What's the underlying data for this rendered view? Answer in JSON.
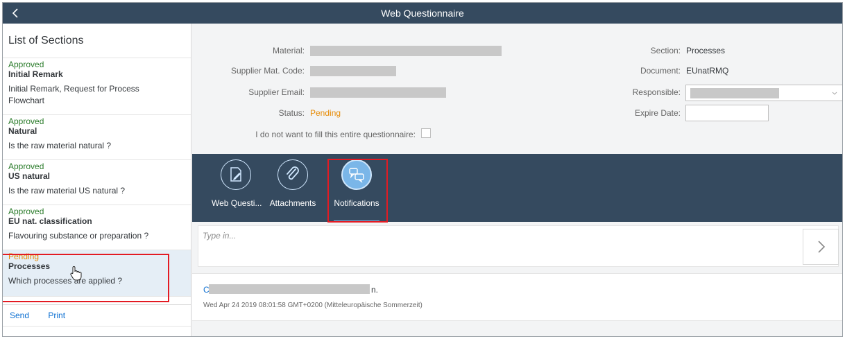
{
  "app": {
    "title": "Web Questionnaire",
    "back_glyph": "‹"
  },
  "master": {
    "header": "List of Sections",
    "items": [
      {
        "status": "Approved",
        "name": "Initial Remark",
        "desc": "Initial Remark, Request for Process Flowchart"
      },
      {
        "status": "Approved",
        "name": "Natural",
        "desc": "Is the raw material natural ?"
      },
      {
        "status": "Approved",
        "name": "US natural",
        "desc": "Is the raw material US natural ?"
      },
      {
        "status": "Approved",
        "name": "EU nat. classification",
        "desc": "Flavouring substance or preparation ?"
      },
      {
        "status": "Pending",
        "name": "Processes",
        "desc": "Which processes are applied ?"
      }
    ],
    "footer": {
      "send": "Send",
      "print": "Print"
    }
  },
  "form": {
    "material_label": "Material:",
    "supplier_code_label": "Supplier Mat. Code:",
    "supplier_email_label": "Supplier Email:",
    "status_label": "Status:",
    "status_value": "Pending",
    "opt_out_label": "I do not want to fill this entire questionnaire:",
    "section_label": "Section:",
    "section_value": "Processes",
    "document_label": "Document:",
    "document_value": "EUnatRMQ",
    "responsible_label": "Responsible:",
    "expire_label": "Expire Date:"
  },
  "tabs": [
    {
      "label": "Web Questi...",
      "icon": "edit-document-icon"
    },
    {
      "label": "Attachments",
      "icon": "paperclip-icon"
    },
    {
      "label": "Notifications",
      "icon": "discussion-icon"
    }
  ],
  "feed": {
    "placeholder": "Type in...",
    "post_glyph": "›"
  },
  "notification": {
    "author_initial": "C",
    "text_tail": "n.",
    "timestamp": "Wed Apr 24 2019 08:01:58 GMT+0200 (Mitteleuropäische Sommerzeit)"
  },
  "colors": {
    "shell": "#354a5f",
    "approved": "#2b7c2b",
    "pending": "#e78c07",
    "link": "#0a6ed1",
    "highlight": "#e31b23"
  }
}
